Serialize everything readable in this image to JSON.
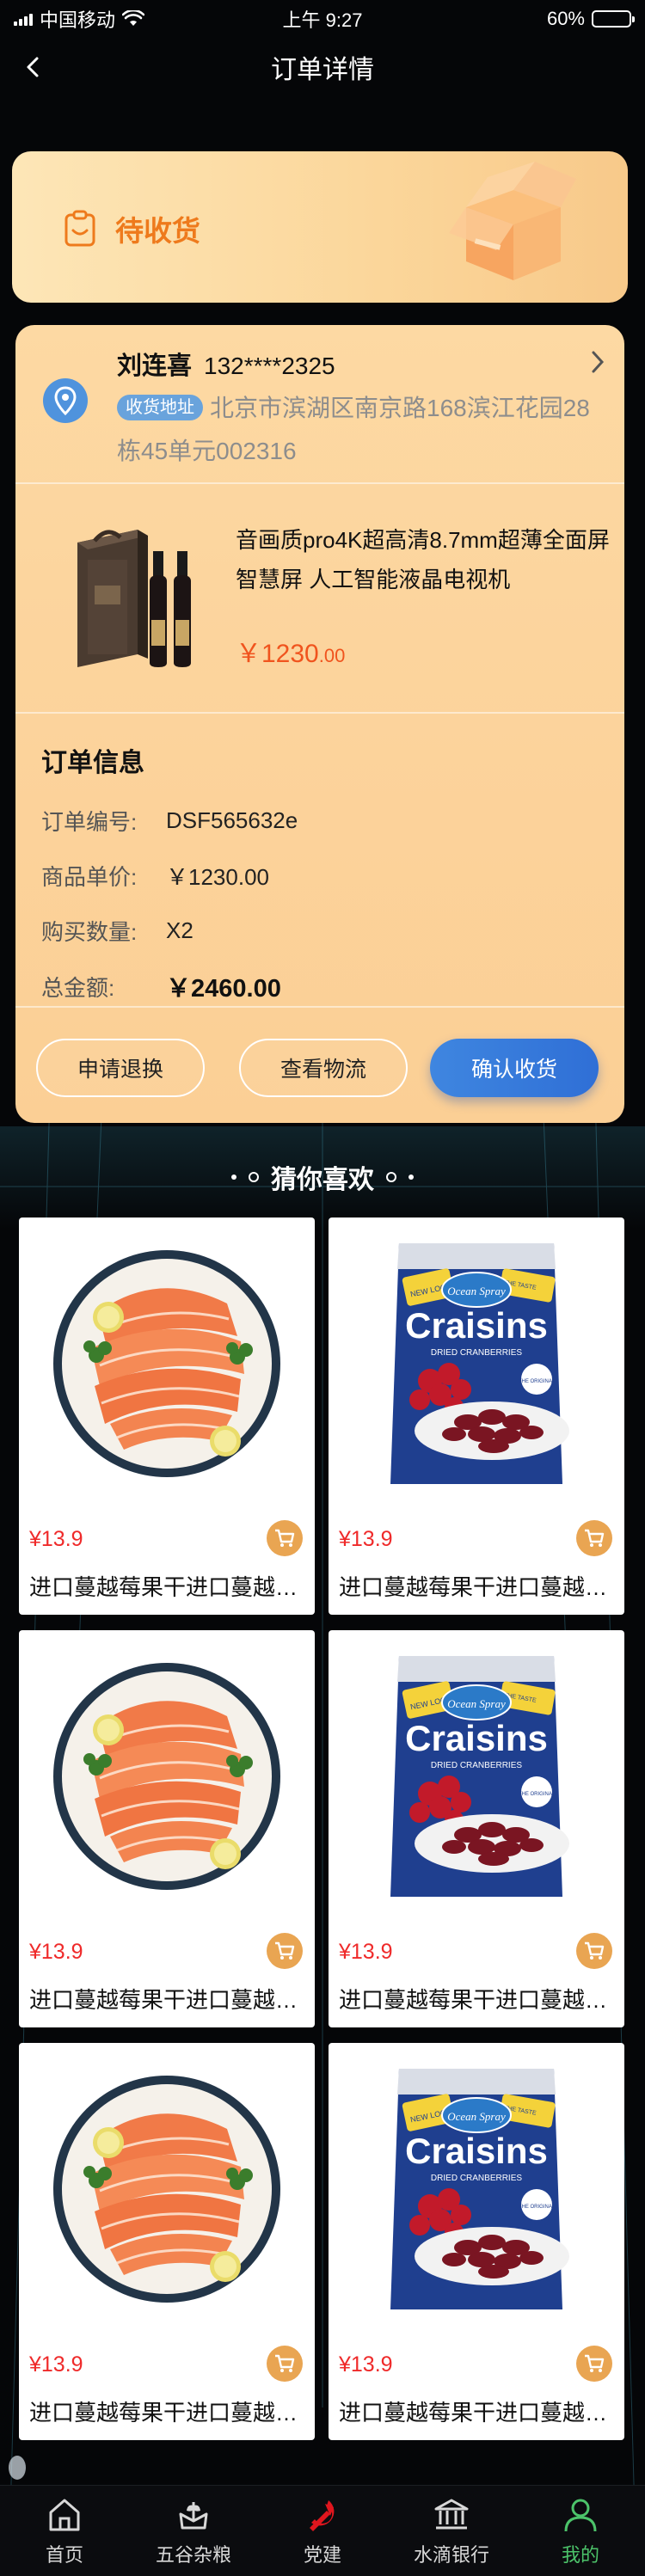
{
  "status_bar": {
    "carrier": "中国移动",
    "time": "上午 9:27",
    "battery": "60%",
    "battery_level": 0.6
  },
  "nav": {
    "title": "订单详情"
  },
  "order_status": {
    "label": "待收货",
    "accent": "#ee7a1c"
  },
  "address": {
    "name": "刘连喜",
    "phone": "132****2325",
    "tag": "收货地址",
    "detail": "北京市滨湖区南京路168滨江花园28栋45单元002316"
  },
  "product": {
    "title": "音画质pro4K超高清8.7mm超薄全面屏 智慧屏 人工智能液晶电视机",
    "price_main": "￥1230",
    "price_cents": ".00"
  },
  "order_info": {
    "title": "订单信息",
    "rows": [
      {
        "key": "订单编号:",
        "value": "DSF565632e"
      },
      {
        "key": "商品单价:",
        "value": "￥1230.00"
      },
      {
        "key": "购买数量:",
        "value": "X2"
      },
      {
        "key": "总金额:",
        "value": "￥2460.00"
      }
    ]
  },
  "actions": {
    "refund": "申请退换",
    "logistics": "查看物流",
    "confirm": "确认收货"
  },
  "recommend": {
    "title": "猜你喜欢",
    "items": [
      {
        "image": "salmon-plate",
        "price": "¥13.9",
        "name": "进口蔓越莓果干进口蔓越莓果干"
      },
      {
        "image": "craisins-bag",
        "price": "¥13.9",
        "name": "进口蔓越莓果干进口蔓越莓果干"
      },
      {
        "image": "salmon-plate",
        "price": "¥13.9",
        "name": "进口蔓越莓果干进口蔓越莓果干"
      },
      {
        "image": "craisins-bag",
        "price": "¥13.9",
        "name": "进口蔓越莓果干进口蔓越莓果干"
      },
      {
        "image": "salmon-plate",
        "price": "¥13.9",
        "name": "进口蔓越莓果干进口蔓越莓果干"
      },
      {
        "image": "craisins-bag",
        "price": "¥13.9",
        "name": "进口蔓越莓果干进口蔓越莓果干"
      }
    ],
    "bag_brand": "Ocean Spray",
    "bag_title": "Craisins",
    "bag_sub": "DRIED CRANBERRIES",
    "bag_badge": "THE ORIGINAL",
    "bag_new": "NEW LOOK!",
    "bag_callout_left": "CHANGING BUT NOT SO",
    "bag_callout_right": "THE TASTE",
    "price_color": "#ef2a2a"
  },
  "tabs": [
    {
      "label": "首页",
      "icon": "home-icon"
    },
    {
      "label": "五谷杂粮",
      "icon": "grain-icon"
    },
    {
      "label": "党建",
      "icon": "party-emblem-icon"
    },
    {
      "label": "水滴银行",
      "icon": "bank-icon"
    },
    {
      "label": "我的",
      "icon": "user-icon"
    }
  ],
  "colors": {
    "active_tab": "#4cc36a",
    "confirm_button": "#3f86e0"
  }
}
